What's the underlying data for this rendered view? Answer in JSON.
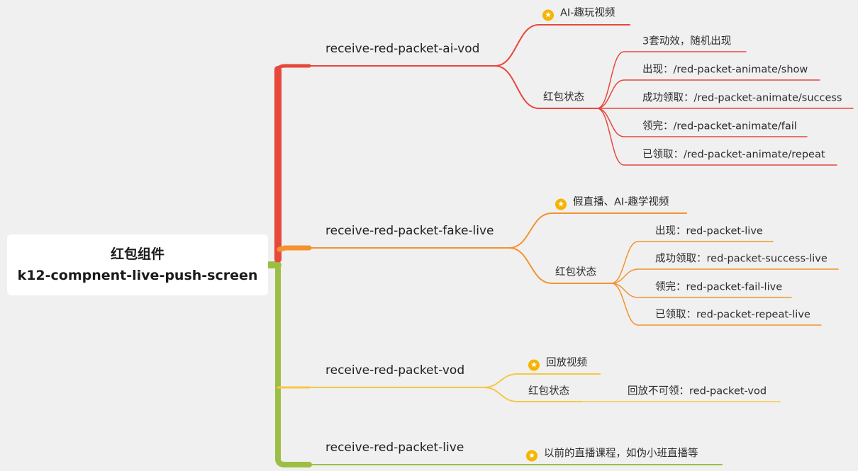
{
  "root": {
    "line1": "红包组件",
    "line2": "k12-compnent-live-push-screen"
  },
  "colors": {
    "red": "#e8473c",
    "orange": "#f3932f",
    "yellow": "#f6c745",
    "green": "#9cbe43"
  },
  "branches": [
    {
      "name": "receive-red-packet-ai-vod",
      "tag": "AI-趣玩视频",
      "state_label": "红包状态",
      "states": [
        "3套动效，随机出现",
        "出现：/red-packet-animate/show",
        "成功领取：/red-packet-animate/success",
        "领完：/red-packet-animate/fail",
        "已领取：/red-packet-animate/repeat"
      ]
    },
    {
      "name": "receive-red-packet-fake-live",
      "tag": "假直播、AI-趣学视频",
      "state_label": "红包状态",
      "states": [
        "出现：red-packet-live",
        "成功领取：red-packet-success-live",
        "领完：red-packet-fail-live",
        "已领取：red-packet-repeat-live"
      ]
    },
    {
      "name": "receive-red-packet-vod",
      "tag": "回放视频",
      "state_label": "红包状态",
      "states": [
        "回放不可领：red-packet-vod"
      ]
    },
    {
      "name": "receive-red-packet-live",
      "tag": "以前的直播课程，如伪小班直播等"
    }
  ]
}
